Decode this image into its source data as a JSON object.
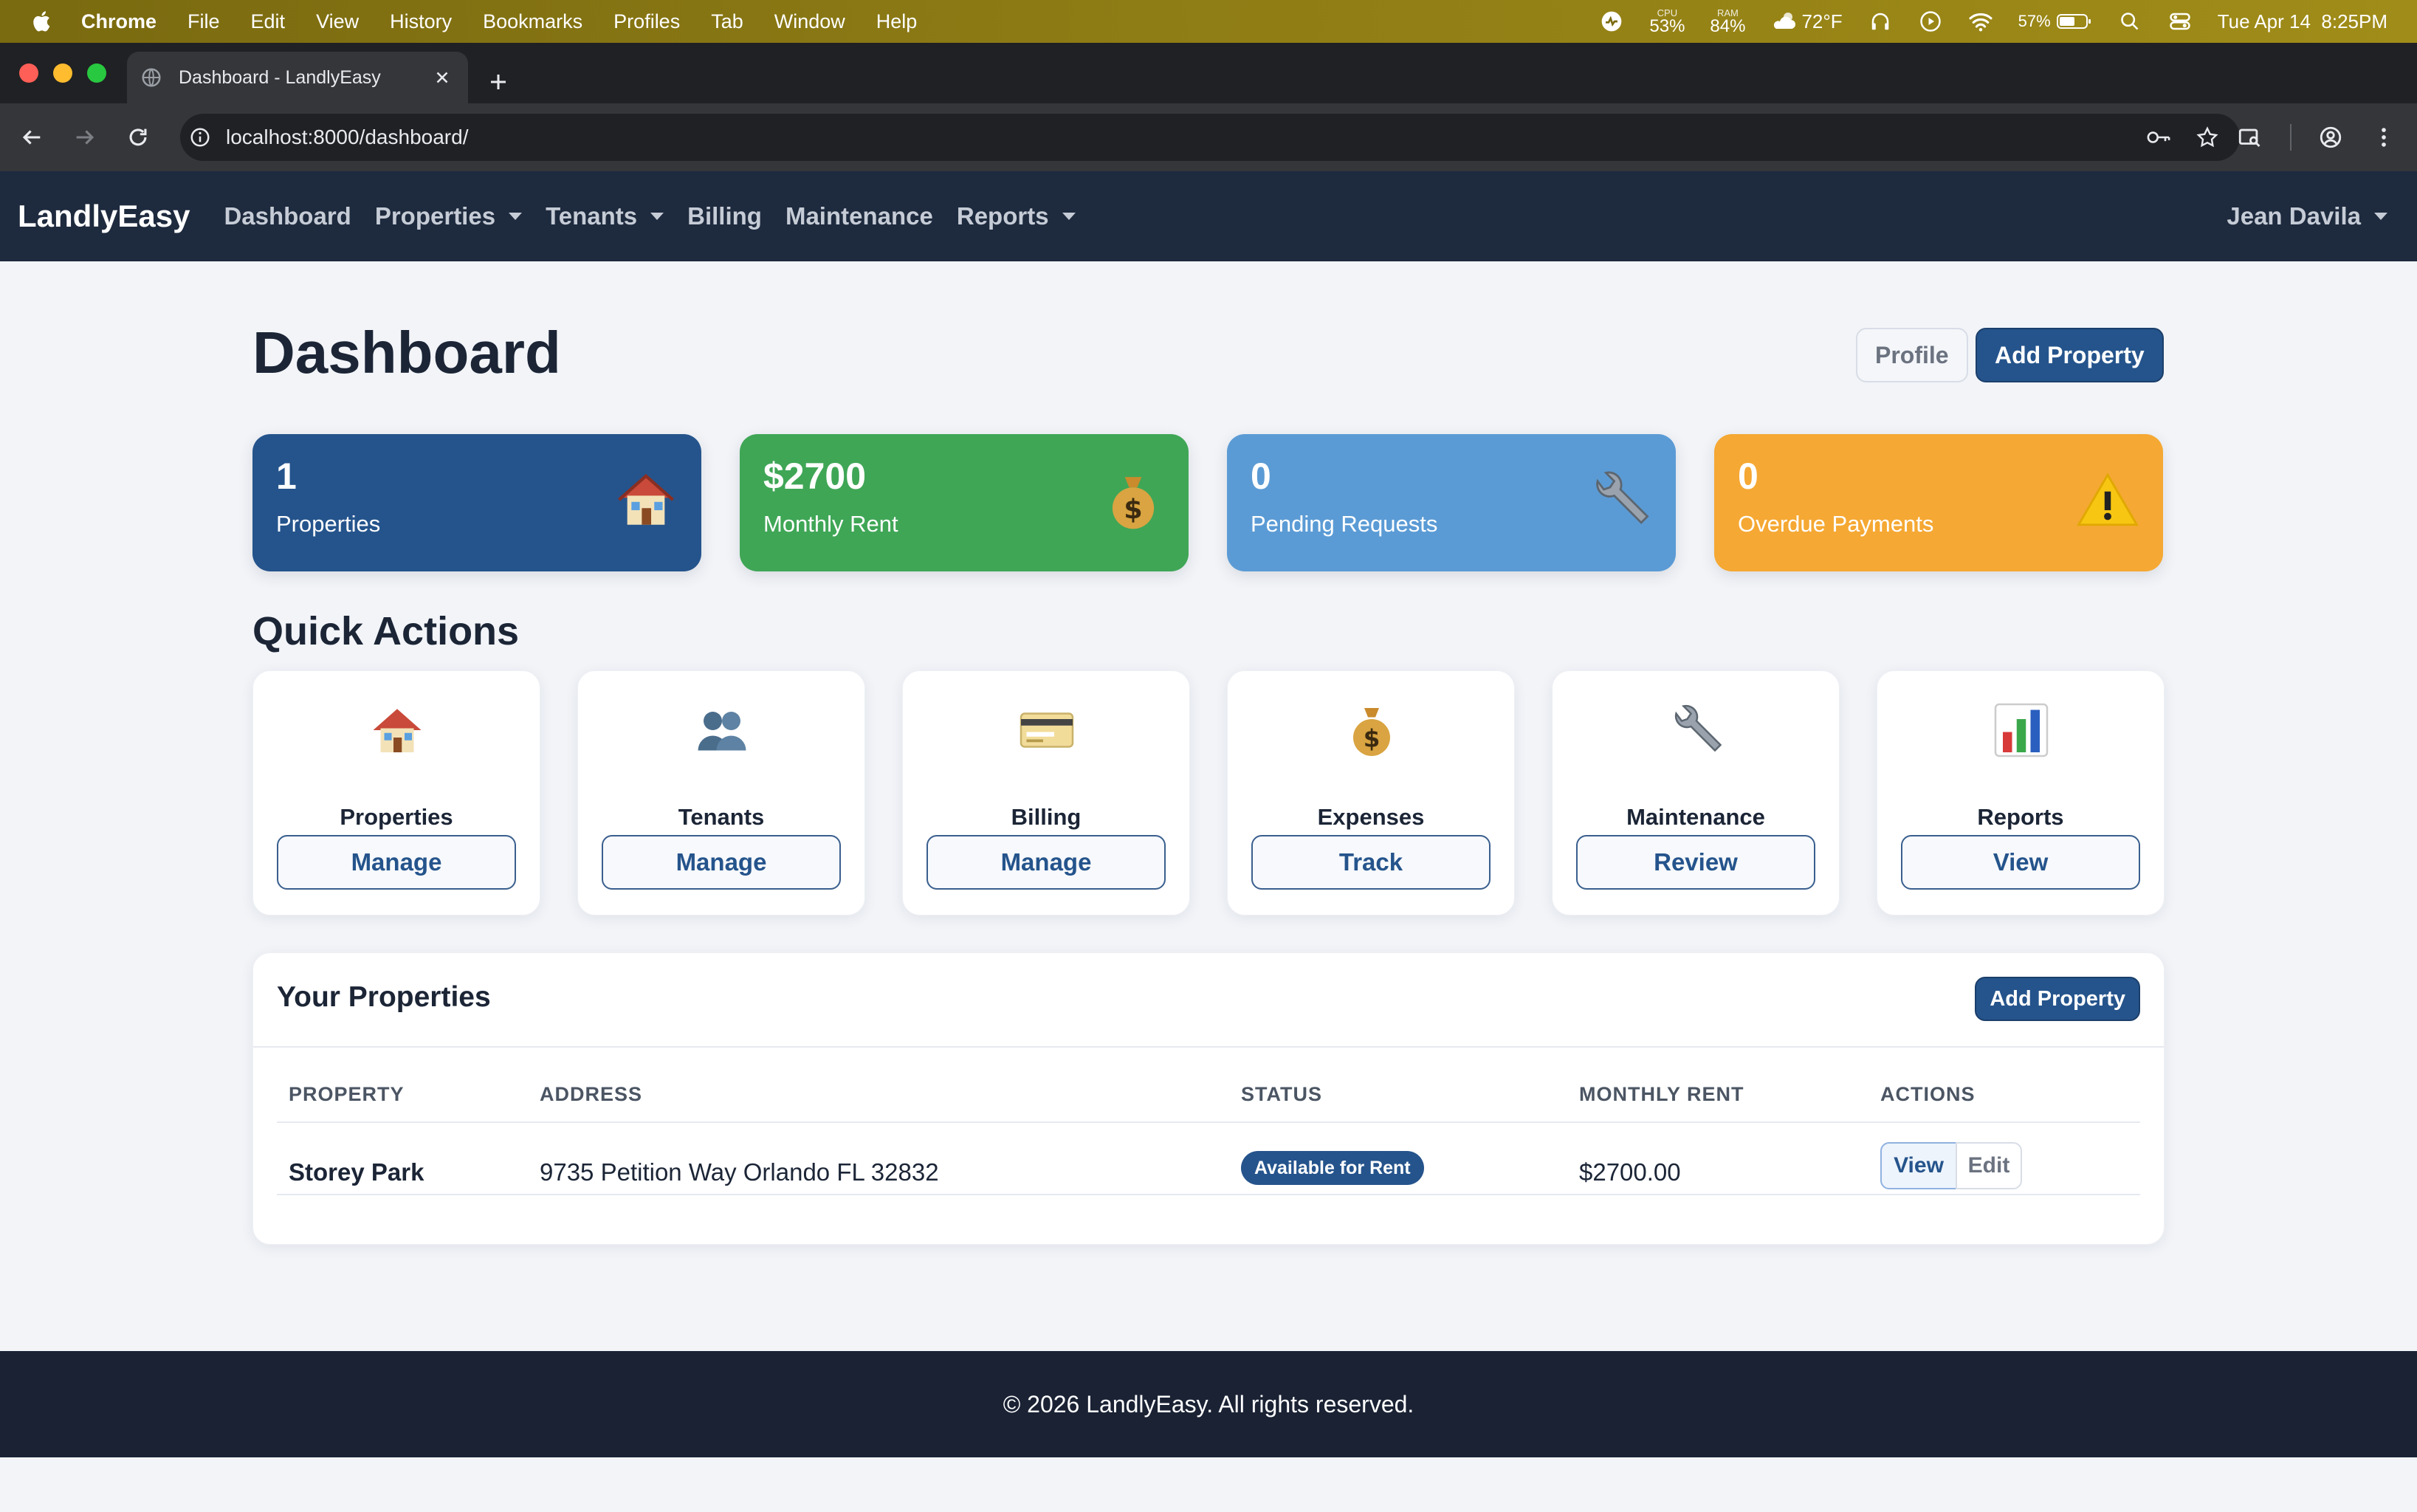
{
  "menubar": {
    "app": "Chrome",
    "items": [
      "File",
      "Edit",
      "View",
      "History",
      "Bookmarks",
      "Profiles",
      "Tab",
      "Window",
      "Help"
    ],
    "cpu_label": "CPU",
    "cpu_value": "53%",
    "ram_label": "RAM",
    "ram_value": "84%",
    "weather": "72°F",
    "battery": "57%",
    "datetime": "Tue Apr 14  8:25PM"
  },
  "browser": {
    "tab_title": "Dashboard - LandlyEasy",
    "url": "localhost:8000/dashboard/"
  },
  "navbar": {
    "brand": "LandlyEasy",
    "links": [
      {
        "label": "Dashboard",
        "dropdown": false
      },
      {
        "label": "Properties",
        "dropdown": true
      },
      {
        "label": "Tenants",
        "dropdown": true
      },
      {
        "label": "Billing",
        "dropdown": false
      },
      {
        "label": "Maintenance",
        "dropdown": false
      },
      {
        "label": "Reports",
        "dropdown": true
      }
    ],
    "user": "Jean Davila"
  },
  "page": {
    "title": "Dashboard",
    "profile_button": "Profile",
    "add_property_button": "Add Property"
  },
  "stats": [
    {
      "value": "1",
      "label": "Properties",
      "color": "#25548c",
      "icon": "house-icon"
    },
    {
      "value": "$2700",
      "label": "Monthly Rent",
      "color": "#3fa656",
      "icon": "money-bag-icon"
    },
    {
      "value": "0",
      "label": "Pending Requests",
      "color": "#5b9bd5",
      "icon": "wrench-icon"
    },
    {
      "value": "0",
      "label": "Overdue Payments",
      "color": "#f5a833",
      "icon": "warning-icon"
    }
  ],
  "quick_actions": {
    "title": "Quick Actions",
    "items": [
      {
        "title": "Properties",
        "button": "Manage",
        "icon": "house-icon"
      },
      {
        "title": "Tenants",
        "button": "Manage",
        "icon": "people-icon"
      },
      {
        "title": "Billing",
        "button": "Manage",
        "icon": "credit-card-icon"
      },
      {
        "title": "Expenses",
        "button": "Track",
        "icon": "money-bag-icon"
      },
      {
        "title": "Maintenance",
        "button": "Review",
        "icon": "wrench-icon"
      },
      {
        "title": "Reports",
        "button": "View",
        "icon": "bar-chart-icon"
      }
    ]
  },
  "properties": {
    "title": "Your Properties",
    "add_button": "Add Property",
    "columns": [
      "PROPERTY",
      "ADDRESS",
      "STATUS",
      "MONTHLY RENT",
      "ACTIONS"
    ],
    "rows": [
      {
        "name": "Storey Park",
        "address": "9735 Petition Way Orlando FL 32832",
        "status": "Available for Rent",
        "rent": "$2700.00",
        "view": "View",
        "edit": "Edit"
      }
    ]
  },
  "footer": {
    "text": "© 2026 LandlyEasy. All rights reserved."
  }
}
